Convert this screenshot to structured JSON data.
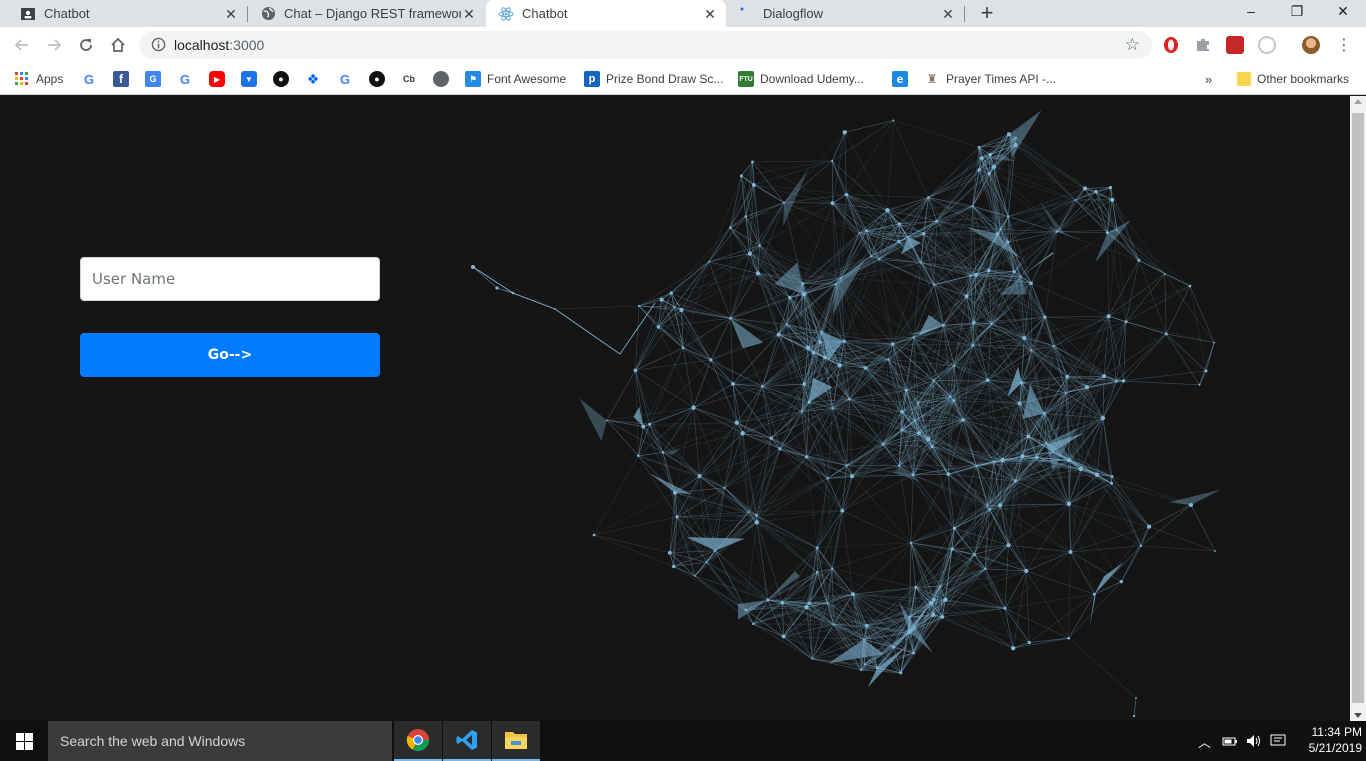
{
  "browser": {
    "tabs": [
      {
        "title": "Chatbot",
        "active": false
      },
      {
        "title": "Chat – Django REST framework",
        "active": false
      },
      {
        "title": "Chatbot",
        "active": true
      },
      {
        "title": "Dialogflow",
        "active": false
      }
    ],
    "new_tab_label": "+",
    "window_controls": {
      "minimize": "–",
      "restore": "❐",
      "close": "✕"
    },
    "url_host": "localhost",
    "url_port": ":3000",
    "bookmarks": [
      {
        "label": "Apps",
        "icon": "apps-grid-icon"
      },
      {
        "label": "",
        "icon": "google-icon"
      },
      {
        "label": "",
        "icon": "facebook-icon"
      },
      {
        "label": "",
        "icon": "google-translate-icon"
      },
      {
        "label": "",
        "icon": "google-icon"
      },
      {
        "label": "",
        "icon": "youtube-icon"
      },
      {
        "label": "",
        "icon": "pocket-icon"
      },
      {
        "label": "",
        "icon": "github-icon"
      },
      {
        "label": "",
        "icon": "dropbox-icon"
      },
      {
        "label": "",
        "icon": "google-icon"
      },
      {
        "label": "",
        "icon": "github-icon"
      },
      {
        "label": "",
        "icon": "crunchbase-icon"
      },
      {
        "label": "",
        "icon": "globe-icon"
      },
      {
        "label": "Font Awesome",
        "icon": "font-awesome-icon"
      },
      {
        "label": "Prize Bond Draw Sc...",
        "icon": "prize-bond-icon"
      },
      {
        "label": "Download Udemy...",
        "icon": "ftu-icon"
      },
      {
        "label": "",
        "icon": "e-icon"
      },
      {
        "label": "Prayer Times API -...",
        "icon": "mosque-icon"
      }
    ],
    "bookmarks_overflow": "»",
    "other_bookmarks": "Other bookmarks"
  },
  "page": {
    "username_placeholder": "User Name",
    "go_button_label": "Go-->"
  },
  "taskbar": {
    "search_placeholder": "Search the web and Windows",
    "apps": [
      "chrome-icon",
      "vscode-icon",
      "file-explorer-icon"
    ],
    "time": "11:34 PM",
    "date": "5/21/2019"
  },
  "colors": {
    "page_background": "#151515",
    "network_line": "#7fb5d5",
    "button_primary": "#007bff",
    "taskbar": "#101010"
  }
}
